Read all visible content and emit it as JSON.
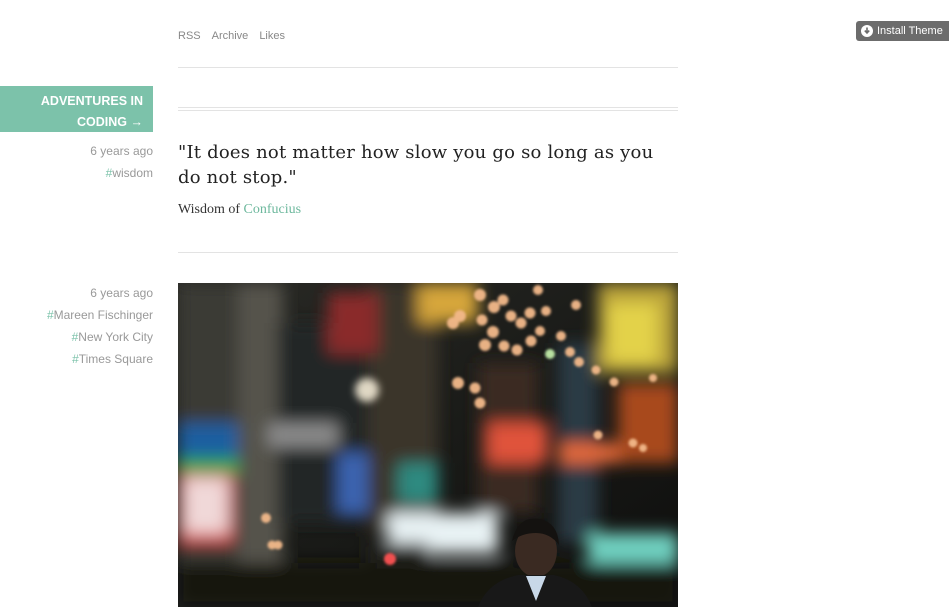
{
  "install_theme": {
    "label": "Install Theme"
  },
  "nav": {
    "items": [
      "RSS",
      "Archive",
      "Likes"
    ]
  },
  "blog": {
    "title_line1": "ADVENTURES IN",
    "title_line2": "CODING →"
  },
  "posts": [
    {
      "time": "6 years ago",
      "tags": [
        "wisdom"
      ],
      "quote": "\"It does not matter how slow you go so long as you do not stop.\"",
      "source_prefix": "Wisdom of ",
      "source_name": "Confucius"
    },
    {
      "time": "6 years ago",
      "tags": [
        "Mareen Fischinger",
        "New York City",
        "Times Square"
      ]
    }
  ],
  "colors": {
    "accent": "#7cc2aa",
    "button_bg": "#6c6c6c"
  }
}
